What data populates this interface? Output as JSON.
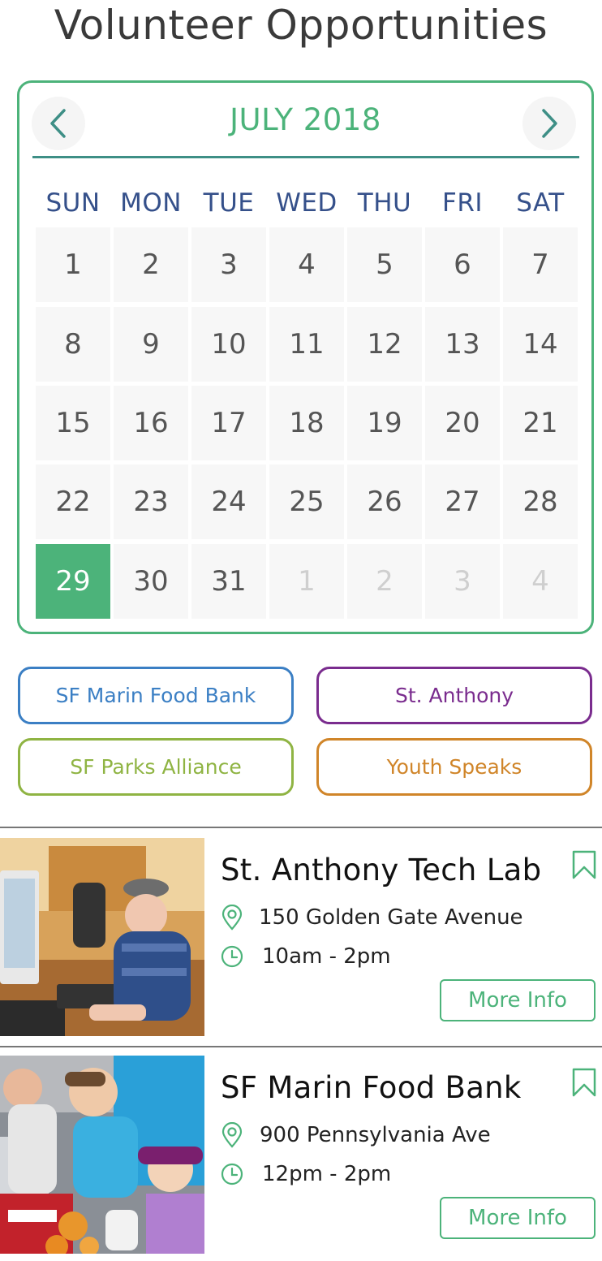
{
  "page": {
    "title": "Volunteer Opportunities"
  },
  "calendar": {
    "month_label": "JULY 2018",
    "prev_icon": "chevron-left-icon",
    "next_icon": "chevron-right-icon",
    "weekdays": [
      "SUN",
      "MON",
      "TUE",
      "WED",
      "THU",
      "FRI",
      "SAT"
    ],
    "weeks": [
      [
        "1",
        "2",
        "3",
        "4",
        "5",
        "6",
        "7"
      ],
      [
        "8",
        "9",
        "10",
        "11",
        "12",
        "13",
        "14"
      ],
      [
        "15",
        "16",
        "17",
        "18",
        "19",
        "20",
        "21"
      ],
      [
        "22",
        "23",
        "24",
        "25",
        "26",
        "27",
        "28"
      ],
      [
        "29",
        "30",
        "31",
        "1",
        "2",
        "3",
        "4"
      ]
    ],
    "selected_day": "29",
    "accent_color": "#4cb37a"
  },
  "filters": [
    {
      "label": "SF Marin Food Bank",
      "color": "#3b7fc4"
    },
    {
      "label": "St. Anthony",
      "color": "#7a2c8e"
    },
    {
      "label": "SF Parks Alliance",
      "color": "#8fb443"
    },
    {
      "label": "Youth Speaks",
      "color": "#d08529"
    }
  ],
  "opportunities": [
    {
      "title": "St. Anthony Tech Lab",
      "address": "150 Golden Gate Avenue",
      "time": "10am - 2pm",
      "button_label": "More Info",
      "image_icon": "photo-computer-lab"
    },
    {
      "title": "SF Marin Food Bank",
      "address": "900 Pennsylvania Ave",
      "time": "12pm - 2pm",
      "button_label": "More Info",
      "image_icon": "photo-food-bank"
    }
  ]
}
